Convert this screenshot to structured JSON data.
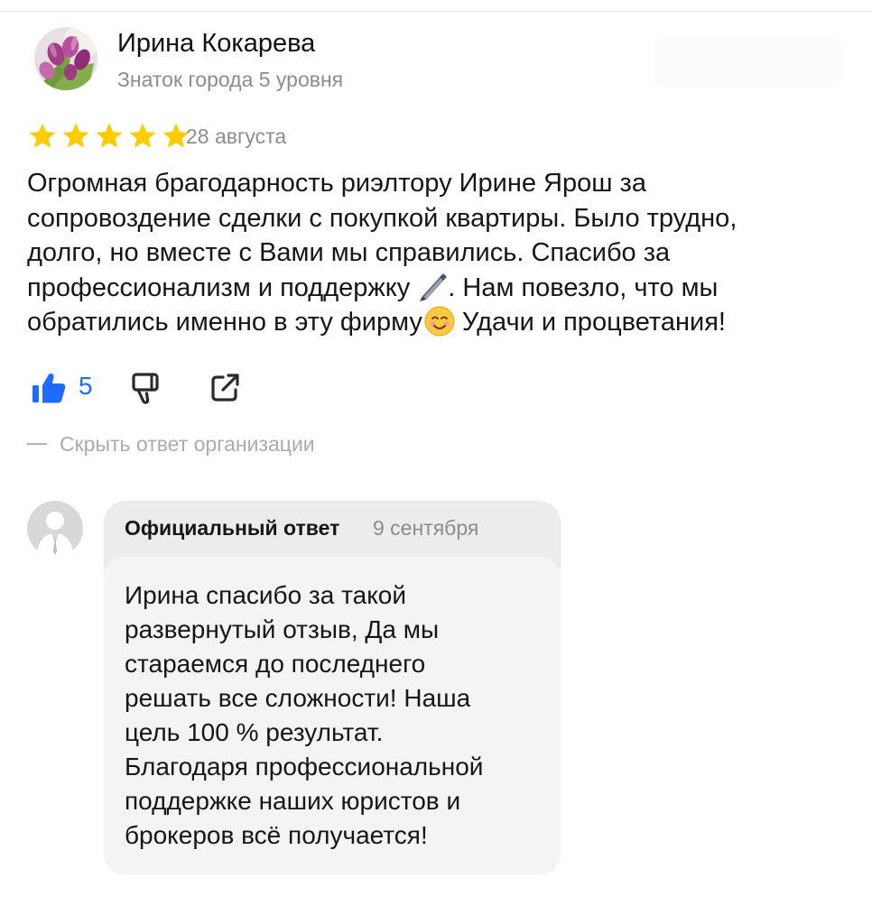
{
  "review": {
    "author_name": "Ирина Кокарева",
    "author_level": "Знаток города 5 уровня",
    "rating": 5,
    "date": "28 августа",
    "text_lines": [
      "Огромная брагодарность риэлтору Ирине Ярош за",
      "сопровоздение сделки с покупкой квартиры. Было трудно,",
      "долго, но вместе с Вами мы справились. Спасибо за",
      "профессионализм и поддержку",
      ". Нам повезло, что мы",
      "обратились именно в эту фирму",
      " Удачи и процветания!"
    ],
    "likes": "5"
  },
  "icons": {
    "avatar": "tulips-photo-avatar",
    "star": "star-icon",
    "pen": "pen-emoji",
    "smile": "smiling-face-emoji",
    "like": "thumbs-up-icon",
    "dislike": "thumbs-down-icon",
    "share": "share-icon",
    "org_avatar": "default-user-avatar"
  },
  "colors": {
    "star": "#FFCC00",
    "like_blue": "#1F6BFF",
    "muted_text": "#8C8C8C",
    "card_bg": "#ECECEC"
  },
  "response": {
    "toggle_label": "Скрыть ответ организации",
    "label": "Официальный ответ",
    "date": "9 сентября",
    "text_lines": [
      "Ирина спасибо за такой",
      "развернутый отзыв, Да мы",
      "стараемся до последнего",
      "решать все сложности! Наша",
      "цель 100 % результат.",
      "Благодаря профессиональной",
      "поддержке наших юристов и",
      "брокеров всё получается!"
    ]
  }
}
